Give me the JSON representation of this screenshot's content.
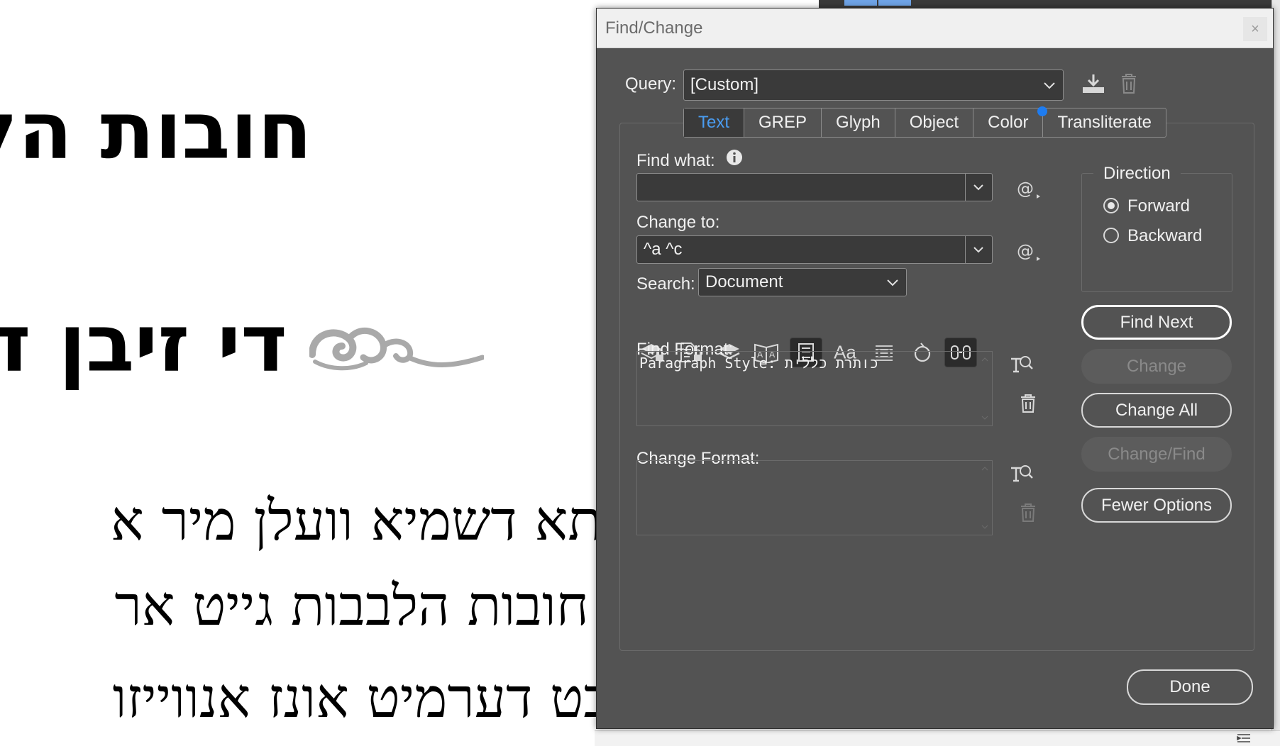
{
  "document": {
    "lines": [
      "חובות הלב",
      "די זיבן ד",
      "תא דשמיא וועלן מיר א",
      "חובות הלבבות גייט אר",
      "בט דערמיט אונז אנווייזו"
    ]
  },
  "dialog": {
    "title": "Find/Change",
    "close": "×",
    "query_label": "Query:",
    "query_value": "[Custom]",
    "tabs": [
      {
        "label": "Text",
        "active": true
      },
      {
        "label": "GREP",
        "active": false
      },
      {
        "label": "Glyph",
        "active": false
      },
      {
        "label": "Object",
        "active": false
      },
      {
        "label": "Color",
        "active": false
      },
      {
        "label": "Transliterate",
        "active": false
      }
    ],
    "find_what_label": "Find what:",
    "find_what_value": "",
    "change_to_label": "Change to:",
    "change_to_value": "^a ^c",
    "search_label": "Search:",
    "search_value": "Document",
    "find_format_label": "Find Format:",
    "find_format_value": "Paragraph Style: כותרת כללית",
    "change_format_label": "Change Format:",
    "change_format_value": "",
    "direction": {
      "legend": "Direction",
      "forward": "Forward",
      "backward": "Backward",
      "selected": "Forward"
    },
    "buttons": {
      "find_next": "Find Next",
      "change": "Change",
      "change_all": "Change All",
      "change_find": "Change/Find",
      "fewer_options": "Fewer Options",
      "done": "Done"
    },
    "search_options": {
      "case_label": "Aa"
    },
    "colors": {
      "dialog_bg": "#535353",
      "field_bg": "#3a3a3a",
      "active_tab_text": "#4a9cf0",
      "badge": "#1e7cf0"
    }
  }
}
